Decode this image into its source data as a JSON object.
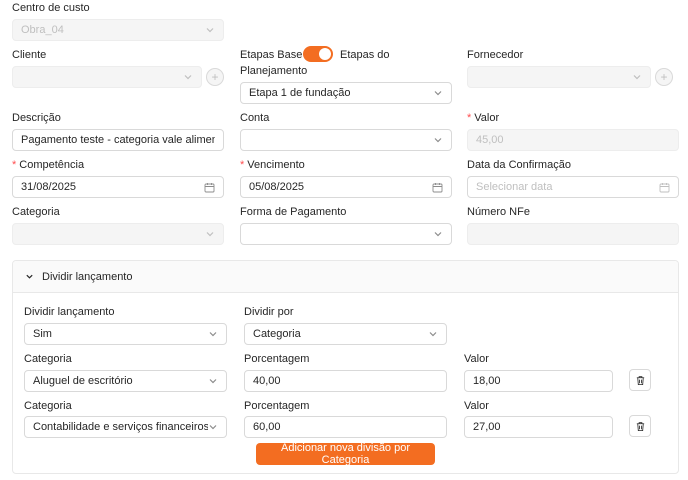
{
  "form": {
    "centro_custo": {
      "label": "Centro de custo",
      "value": "Obra_04"
    },
    "cliente": {
      "label": "Cliente",
      "value": ""
    },
    "etapas": {
      "label_left": "Etapas Base",
      "label_right": "Etapas do",
      "label_right_2": "Planejamento",
      "toggle_on": true,
      "value": "Etapa 1 de fundação"
    },
    "fornecedor": {
      "label": "Fornecedor",
      "value": ""
    },
    "descricao": {
      "label": "Descrição",
      "value": "Pagamento teste - categoria vale alimentação"
    },
    "conta": {
      "label": "Conta",
      "value": ""
    },
    "valor": {
      "required_mark": "*",
      "label": "Valor",
      "value": "45,00"
    },
    "competencia": {
      "required_mark": "*",
      "label": "Competência",
      "value": "31/08/2025"
    },
    "vencimento": {
      "required_mark": "*",
      "label": "Vencimento",
      "value": "05/08/2025"
    },
    "data_confirmacao": {
      "label": "Data da Confirmação",
      "placeholder": "Selecionar data"
    },
    "categoria": {
      "label": "Categoria",
      "value": ""
    },
    "forma_pagamento": {
      "label": "Forma de Pagamento",
      "value": ""
    },
    "numero_nfe": {
      "label": "Número NFe",
      "value": ""
    }
  },
  "split": {
    "title": "Dividir lançamento",
    "dividir_label": "Dividir lançamento",
    "dividir_value": "Sim",
    "dividir_por_label": "Dividir por",
    "dividir_por_value": "Categoria",
    "rows": [
      {
        "categoria_label": "Categoria",
        "categoria": "Aluguel de escritório",
        "porcentagem_label": "Porcentagem",
        "porcentagem": "40,00",
        "valor_label": "Valor",
        "valor": "18,00"
      },
      {
        "categoria_label": "Categoria",
        "categoria": "Contabilidade e serviços financeiros",
        "porcentagem_label": "Porcentagem",
        "porcentagem": "60,00",
        "valor_label": "Valor",
        "valor": "27,00"
      }
    ],
    "add_button": "Adicionar nova divisão por Categoria"
  },
  "colors": {
    "accent": "#f36d21",
    "required": "#ff4d4f",
    "border": "#d9d9d9",
    "disabled_bg": "#f5f5f5"
  },
  "icons": {
    "chevron": "chevron-down-icon",
    "calendar": "calendar-icon",
    "plus": "plus-circle-icon",
    "trash": "trash-icon"
  }
}
